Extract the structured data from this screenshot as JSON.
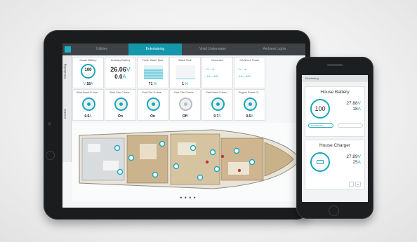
{
  "tablet": {
    "tabs": [
      "Utilities",
      "Entertaining",
      "Vivid Underwater",
      "Ambient Lights"
    ],
    "active_tab": "Entertaining",
    "sidebar": [
      "Monitoring",
      "Control"
    ],
    "monitoring_tiles": [
      {
        "title": "House Battery",
        "gauge": "100",
        "v1": "27.88",
        "u1": "V",
        "v2": "18",
        "u2": "A"
      },
      {
        "title": "Auxiliary Battery",
        "big1": "26.06",
        "big1_unit": "V",
        "big2": "0.0",
        "big2_unit": "A"
      },
      {
        "title": "Fresh Water Tank",
        "pct": "71",
        "level": 0.71
      },
      {
        "title": "Black Tank",
        "pct": "1",
        "level": 0.01
      },
      {
        "title": "Generator",
        "rows": [
          "---V  ---A",
          "---Hz  ---kW"
        ]
      },
      {
        "title": "OA Shore Power",
        "rows": [
          "---V  ---A",
          "---Hz  ---kW"
        ]
      }
    ],
    "control_tiles": [
      {
        "title": "Stbd Head O Hea...",
        "value": "0.6",
        "unit": "A"
      },
      {
        "title": "Stbd Cbn O Hea...",
        "value": "On",
        "unit": ""
      },
      {
        "title": "Port Cbn O Hea...",
        "value": "On",
        "unit": ""
      },
      {
        "title": "Port Cbn Courte...",
        "value": "Off",
        "unit": ""
      },
      {
        "title": "Port Head O Hea...",
        "value": "0.7",
        "unit": "A"
      },
      {
        "title": "Engine Room Ol...",
        "value": "0.6",
        "unit": "A"
      }
    ],
    "page_dots": "● ● ● ●"
  },
  "phone": {
    "header": "Monitoring",
    "card1": {
      "title": "House Battery",
      "gauge": "100",
      "v": "27.88",
      "v_unit": "V",
      "a": "18",
      "a_unit": "A",
      "toggle": "Auto Balance"
    },
    "card2": {
      "title": "House Charger",
      "v": "27.89",
      "v_unit": "V",
      "a": "25",
      "a_unit": "A"
    }
  },
  "colors": {
    "accent": "#1aa7bd",
    "topbar": "#3e4246",
    "active_tab": "#1496ab",
    "device": "#1b1c1e"
  }
}
